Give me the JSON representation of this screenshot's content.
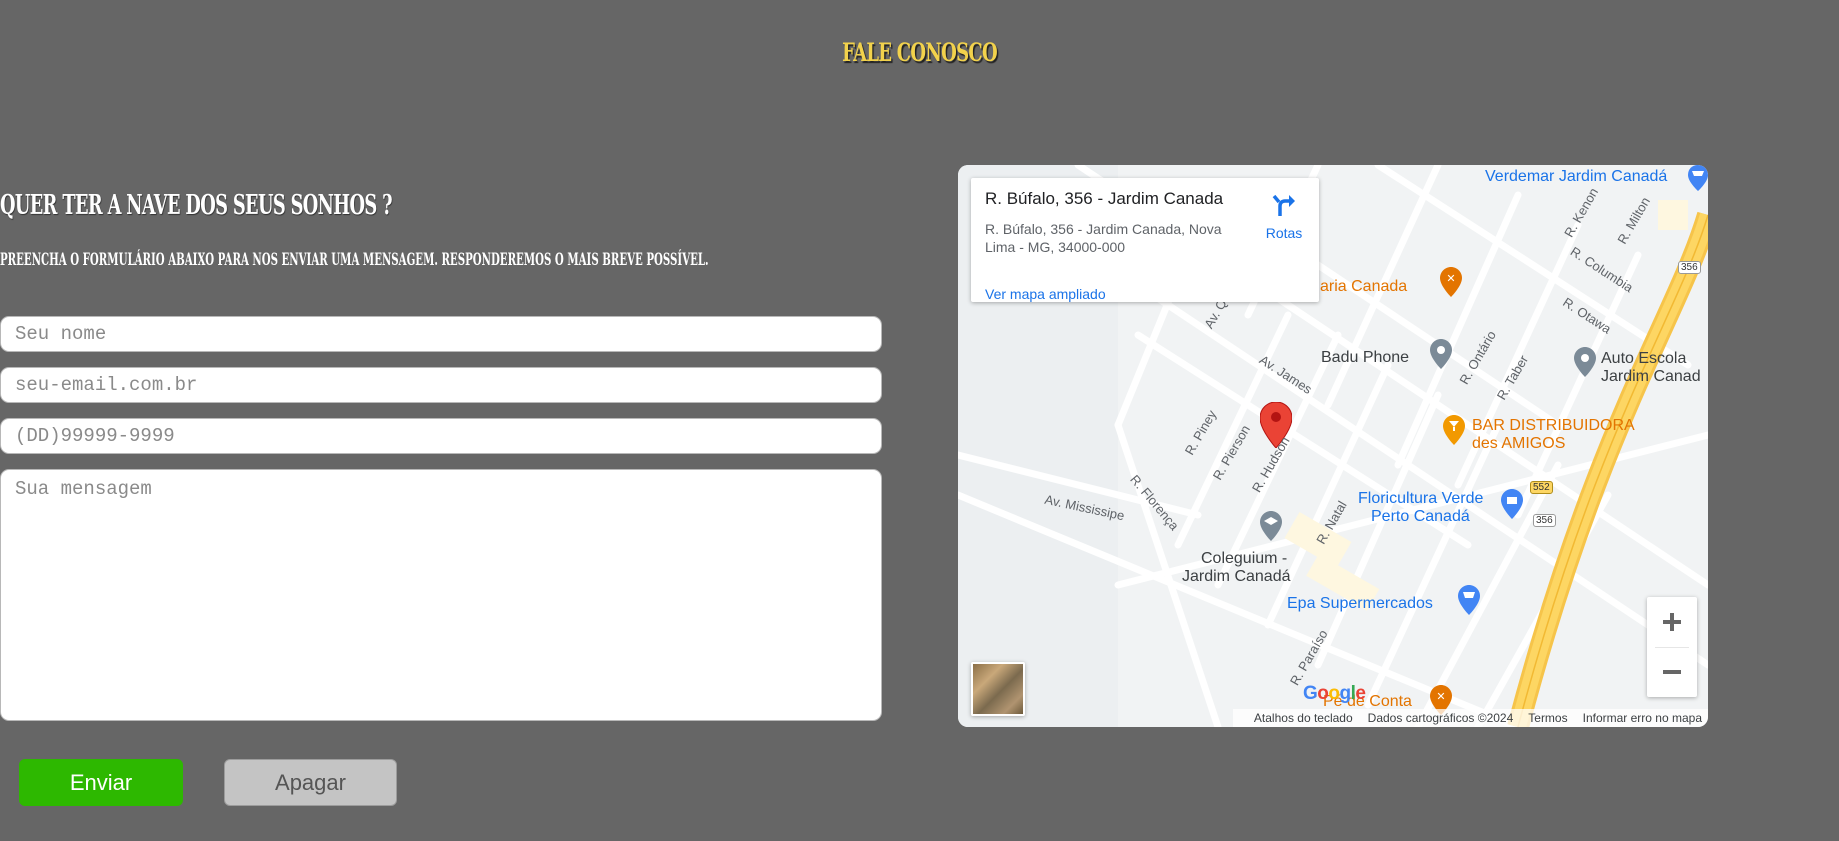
{
  "page": {
    "title": "FALE CONOSCO",
    "headline": "QUER TER A NAVE DOS SEUS SONHOS ?",
    "subline": "PREENCHA O FORMULÁRIO ABAIXO PARA NOS ENVIAR UMA MENSAGEM. RESPONDEREMOS O MAIS BREVE POSSÍVEL."
  },
  "form": {
    "name_placeholder": "Seu nome",
    "email_placeholder": "seu-email.com.br",
    "phone_placeholder": "(DD)99999-9999",
    "message_placeholder": "Sua mensagem",
    "send_label": "Enviar",
    "clear_label": "Apagar"
  },
  "map": {
    "card": {
      "title": "R. Búfalo, 356 - Jardim Canada",
      "address": "R. Búfalo, 356 - Jardim Canada, Nova Lima - MG, 34000-000",
      "directions_label": "Rotas",
      "enlarge_link": "Ver mapa ampliado"
    },
    "places": {
      "verdemar": "Verdemar Jardim Canadá",
      "pizzaria": "aria Canada",
      "badu": "Badu Phone",
      "autoescola_1": "Auto Escola",
      "autoescola_2": "Jardim Canad",
      "bar_1": "BAR DISTRIBUIDORA",
      "bar_2": "des AMIGOS",
      "floricultura_1": "Floricultura Verde",
      "floricultura_2": "Perto Canadá",
      "coleguium_1": "Coleguium -",
      "coleguium_2": "Jardim Canadá",
      "epa": "Epa Supermercados",
      "pedeconta": "Pé de Conta"
    },
    "streets": {
      "kenon": "R. Kenon",
      "milton": "R. Milton",
      "columbia": "R. Columbia",
      "otawa": "R. Otawa",
      "ontario": "R. Ontário",
      "taber": "R. Taber",
      "james": "Av. James",
      "piney": "R. Piney",
      "pierson": "R. Pierson",
      "hudson": "R. Hudson",
      "natal": "R. Natal",
      "florenca": "R. Florença",
      "mississipe": "Av. Mississipe",
      "paraiso": "R. Paraíso",
      "avq": "Av. Qu"
    },
    "shields": {
      "s356a": "356",
      "s356b": "356",
      "s552": "552"
    },
    "google": [
      "G",
      "o",
      "o",
      "g",
      "l",
      "e"
    ],
    "attribution": {
      "keyboard": "Atalhos do teclado",
      "data": "Dados cartográficos ©2024",
      "terms": "Termos",
      "report": "Informar erro no mapa"
    },
    "colors": {
      "highway": "#fdd663",
      "pin": "#ea4335",
      "poi_blue": "#1a73e8",
      "poi_orange": "#e37400"
    }
  }
}
